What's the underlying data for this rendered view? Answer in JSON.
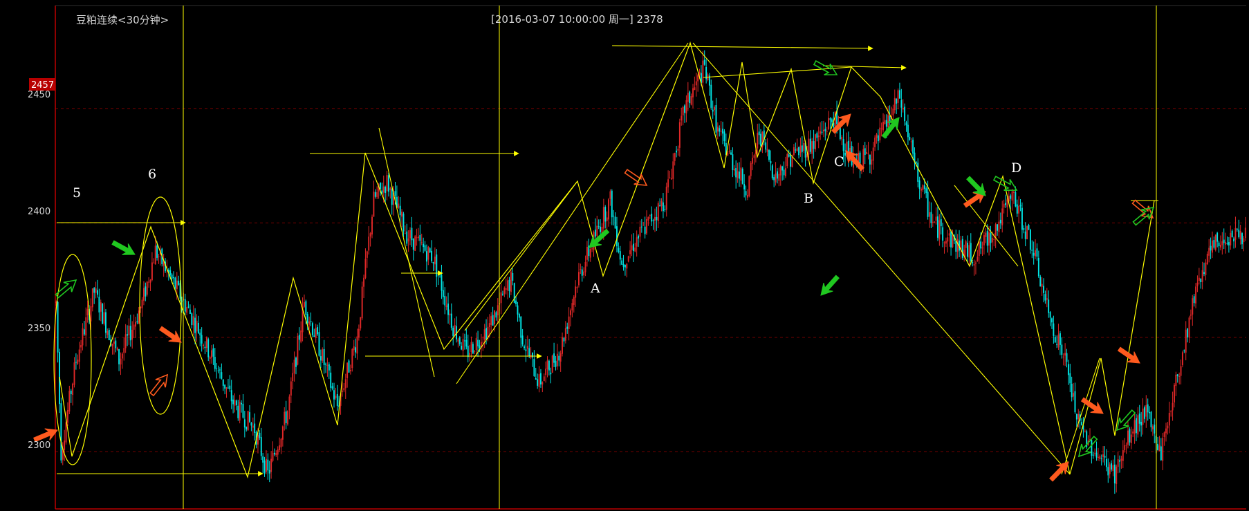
{
  "chart_data": {
    "type": "candlestick",
    "title": "豆粕连续<30分钟>",
    "info": "[2016-03-07  10:00:00 周一]   2378",
    "current_price_tag": "2457",
    "ylim": [
      2275,
      2495
    ],
    "y_ticks": [
      2300,
      2350,
      2400,
      2450
    ],
    "y_tick_labels": [
      "2300",
      "2350",
      "2400",
      "2450"
    ],
    "grid": true,
    "colors": {
      "up": "#e02828",
      "down": "#00e6e6",
      "annotation": "#ffff00",
      "buy_arrow": "#ff5a1e",
      "sell_arrow": "#20c820",
      "grid": "#7a0000",
      "frame": "#c00000"
    },
    "path_points": [
      [
        0,
        2365
      ],
      [
        3,
        2300
      ],
      [
        12,
        2340
      ],
      [
        23,
        2370
      ],
      [
        38,
        2340
      ],
      [
        52,
        2365
      ],
      [
        60,
        2388
      ],
      [
        70,
        2375
      ],
      [
        85,
        2355
      ],
      [
        95,
        2340
      ],
      [
        108,
        2320
      ],
      [
        120,
        2310
      ],
      [
        128,
        2290
      ],
      [
        140,
        2318
      ],
      [
        150,
        2365
      ],
      [
        158,
        2348
      ],
      [
        170,
        2320
      ],
      [
        182,
        2350
      ],
      [
        192,
        2410
      ],
      [
        200,
        2418
      ],
      [
        212,
        2395
      ],
      [
        228,
        2385
      ],
      [
        240,
        2355
      ],
      [
        248,
        2343
      ],
      [
        262,
        2355
      ],
      [
        275,
        2375
      ],
      [
        282,
        2350
      ],
      [
        292,
        2330
      ],
      [
        305,
        2345
      ],
      [
        315,
        2375
      ],
      [
        328,
        2398
      ],
      [
        335,
        2410
      ],
      [
        342,
        2382
      ],
      [
        350,
        2392
      ],
      [
        358,
        2400
      ],
      [
        368,
        2410
      ],
      [
        380,
        2450
      ],
      [
        392,
        2468
      ],
      [
        400,
        2440
      ],
      [
        410,
        2425
      ],
      [
        418,
        2415
      ],
      [
        425,
        2440
      ],
      [
        435,
        2420
      ],
      [
        445,
        2430
      ],
      [
        458,
        2435
      ],
      [
        470,
        2446
      ],
      [
        482,
        2425
      ],
      [
        492,
        2430
      ],
      [
        500,
        2440
      ],
      [
        510,
        2455
      ],
      [
        520,
        2422
      ],
      [
        530,
        2400
      ],
      [
        542,
        2392
      ],
      [
        555,
        2385
      ],
      [
        570,
        2400
      ],
      [
        578,
        2412
      ],
      [
        590,
        2390
      ],
      [
        600,
        2360
      ],
      [
        610,
        2340
      ],
      [
        618,
        2312
      ],
      [
        628,
        2300
      ],
      [
        640,
        2290
      ],
      [
        648,
        2305
      ],
      [
        658,
        2318
      ],
      [
        668,
        2300
      ],
      [
        680,
        2340
      ],
      [
        690,
        2375
      ],
      [
        700,
        2390
      ],
      [
        710,
        2395
      ]
    ],
    "markers": [
      {
        "idx": 40,
        "value": 2339
      },
      {
        "idx": 95,
        "value": 2343
      },
      {
        "idx": 140,
        "value": 2382
      },
      {
        "idx": 260,
        "value": 2350
      },
      {
        "idx": 300,
        "value": 2330
      },
      {
        "idx": 361,
        "value": 2330
      },
      {
        "idx": 415,
        "value": 2430
      }
    ],
    "labels": [
      "5",
      "6",
      "A",
      "B",
      "C",
      "D"
    ]
  }
}
